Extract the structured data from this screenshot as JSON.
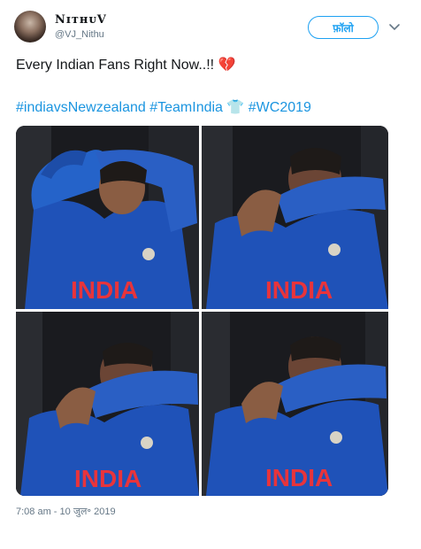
{
  "user": {
    "display_name": "NɪᴛʜᴜⅤ",
    "handle": "@VJ_Nithu",
    "follow_label": "फ़ॉलो"
  },
  "tweet": {
    "text": "Every Indian Fans Right Now..!! 💔",
    "hashtags": [
      "#indiavsNewzealand",
      "#TeamIndia",
      "👕",
      "#WC2019"
    ],
    "timestamp": "7:08 am - 10 जुल॰ 2019"
  },
  "photos": [
    {
      "icon": "photo-cricketer-adjusting-cap",
      "jersey_text": "INDIA"
    },
    {
      "icon": "photo-cricketer-wiping-eyes",
      "jersey_text": "INDIA"
    },
    {
      "icon": "photo-cricketer-wiping-eyes",
      "jersey_text": "INDIA"
    },
    {
      "icon": "photo-cricketer-wiping-eyes",
      "jersey_text": "INDIA"
    }
  ],
  "colors": {
    "link": "#1b95e0",
    "follow_accent": "#1da1f2",
    "jersey_blue": "#1f52b8",
    "jersey_text": "#e8343b"
  },
  "icons": {
    "chevron": "chevron-down-icon"
  }
}
